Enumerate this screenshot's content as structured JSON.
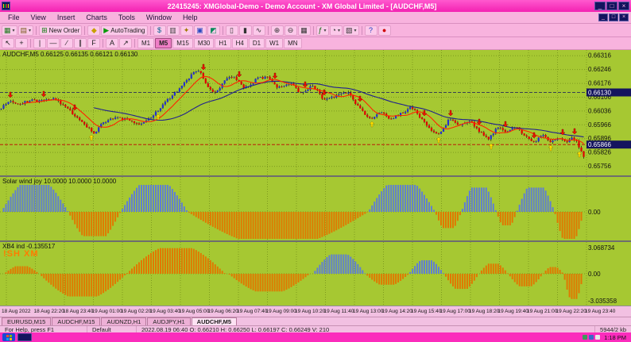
{
  "window": {
    "title": "22415245: XMGlobal-Demo - Demo Account - XM Global Limited - [AUDCHF,M5]",
    "minimize": "_",
    "maximize": "□",
    "close": "×"
  },
  "menu": {
    "items": [
      "File",
      "View",
      "Insert",
      "Charts",
      "Tools",
      "Window",
      "Help"
    ]
  },
  "toolbar_main": {
    "items": [
      {
        "name": "new-chart",
        "glyph": "▦",
        "color": "#1e7a1e",
        "dropdown": true
      },
      {
        "name": "profiles",
        "glyph": "▤",
        "color": "#7a5a1e",
        "dropdown": true
      },
      {
        "sep": true
      },
      {
        "name": "new-order",
        "glyph": "⊞",
        "color": "#0a7a0a",
        "label": "New Order"
      },
      {
        "sep": true
      },
      {
        "name": "metaeditor",
        "glyph": "◆",
        "color": "#c8a000"
      },
      {
        "name": "autotrading",
        "glyph": "▶",
        "color": "#0a9a0a",
        "label": "AutoTrading"
      },
      {
        "sep": true
      },
      {
        "name": "market-watch",
        "glyph": "$",
        "color": "#00608a"
      },
      {
        "name": "data-window",
        "glyph": "▥",
        "color": "#444444"
      },
      {
        "name": "navigator",
        "glyph": "✦",
        "color": "#a07a00"
      },
      {
        "name": "terminal",
        "glyph": "▣",
        "color": "#2a4ac0"
      },
      {
        "name": "strategy-tester",
        "glyph": "◩",
        "color": "#0a8a5a"
      },
      {
        "sep": true
      },
      {
        "name": "chart-bars",
        "glyph": "▯",
        "color": "#333333"
      },
      {
        "name": "chart-candles",
        "glyph": "▮",
        "color": "#333333"
      },
      {
        "name": "chart-line",
        "glyph": "∿",
        "color": "#333333"
      },
      {
        "sep": true
      },
      {
        "name": "zoom-in",
        "glyph": "⊕",
        "color": "#333333"
      },
      {
        "name": "zoom-out",
        "glyph": "⊖",
        "color": "#333333"
      },
      {
        "name": "tile-windows",
        "glyph": "▦",
        "color": "#333333"
      },
      {
        "sep": true
      },
      {
        "name": "indicators",
        "glyph": "ƒ",
        "color": "#0a6a0a",
        "dropdown": true
      },
      {
        "name": "periods",
        "glyph": "◔",
        "color": "#333333",
        "dropdown": true
      },
      {
        "name": "templates",
        "glyph": "▧",
        "color": "#333333",
        "dropdown": true
      },
      {
        "sep": true
      },
      {
        "name": "help",
        "glyph": "?",
        "color": "#1a3ac0"
      },
      {
        "name": "record",
        "glyph": "●",
        "color": "#d00000"
      }
    ]
  },
  "toolbar_tools": {
    "items": [
      {
        "name": "cursor-tool",
        "glyph": "↖",
        "color": "#222222"
      },
      {
        "name": "crosshair-tool",
        "glyph": "+",
        "color": "#222222"
      },
      {
        "sep": true
      },
      {
        "name": "vertical-line-tool",
        "glyph": "|",
        "color": "#222222"
      },
      {
        "name": "horizontal-line-tool",
        "glyph": "—",
        "color": "#222222"
      },
      {
        "name": "trendline-tool",
        "glyph": "∕",
        "color": "#222222"
      },
      {
        "name": "channel-tool",
        "glyph": "∥",
        "color": "#222222"
      },
      {
        "name": "fibonacci-tool",
        "glyph": "F",
        "color": "#222222"
      },
      {
        "sep": true
      },
      {
        "name": "text-tool",
        "glyph": "A",
        "color": "#222222"
      },
      {
        "name": "arrows-tool",
        "glyph": "↗",
        "color": "#222222"
      },
      {
        "sep": true
      }
    ]
  },
  "timeframes": {
    "items": [
      "M1",
      "M5",
      "M15",
      "M30",
      "H1",
      "H4",
      "D1",
      "W1",
      "MN"
    ],
    "active": "M5"
  },
  "chart": {
    "symbol_label": "AUDCHF,M5  0.66125 0.66135 0.66121 0.66130",
    "price_axis": [
      "0.66316",
      "0.66246",
      "0.66176",
      "0.66106",
      "0.66036",
      "0.65966",
      "0.65896",
      "0.65826",
      "0.65756"
    ],
    "price_box_upper": "0.66130",
    "price_box_lower": "0.65866",
    "time_axis": [
      "18 Aug 2022",
      "18 Aug 22:20",
      "18 Aug 23:40",
      "19 Aug 01:00",
      "19 Aug 02:20",
      "19 Aug 03:40",
      "19 Aug 05:00",
      "19 Aug 06:20",
      "19 Aug 07:40",
      "19 Aug 09:00",
      "19 Aug 10:20",
      "19 Aug 11:40",
      "19 Aug 13:00",
      "19 Aug 14:20",
      "19 Aug 15:40",
      "19 Aug 17:00",
      "19 Aug 18:20",
      "19 Aug 19:40",
      "19 Aug 21:00",
      "19 Aug 22:20",
      "19 Aug 23:40"
    ]
  },
  "indicator1": {
    "label": "Solar wind joy 10.0000 10.0000 10.0000",
    "zero_label": "0.00"
  },
  "indicator2": {
    "label": "XB4 ind -0.135517",
    "watermark": "!SH XM",
    "max_label": "3.068734",
    "zero_label": "0.00",
    "min_label": "-3.035358"
  },
  "tabs": {
    "items": [
      "EURUSD,M15",
      "AUDCHF,M15",
      "AUDNZD,H1",
      "AUDJPY,H1",
      "AUDCHF,M5"
    ],
    "active": "AUDCHF,M5"
  },
  "status_bar": {
    "help": "For Help, press F1",
    "profile": "Default",
    "ohlc": "2022.08.19 06:40   O: 0.66210   H: 0.66250   L: 0.66197   C: 0.66249   V: 210",
    "connection": "5944/2 kb"
  },
  "taskbar": {
    "clock": "1:18 PM"
  },
  "chart_data": {
    "type": "candlestick",
    "symbol": "AUDCHF",
    "timeframe": "M5",
    "candle_count": 246,
    "price_range": {
      "top": 0.66345,
      "bottom": 0.6571
    },
    "grid_prices": [
      0.66316,
      0.66246,
      0.66176,
      0.66106,
      0.66036,
      0.65966,
      0.65896,
      0.65826,
      0.65756
    ],
    "bid_line": 0.65866,
    "level_line": 0.6613,
    "ma_fast_period": 10,
    "ma_slow_period": 40,
    "price_keypoints": [
      [
        0,
        0.66055
      ],
      [
        0.012,
        0.66085
      ],
      [
        0.03,
        0.6607
      ],
      [
        0.05,
        0.6609
      ],
      [
        0.07,
        0.66085
      ],
      [
        0.09,
        0.661
      ],
      [
        0.11,
        0.66055
      ],
      [
        0.13,
        0.66005
      ],
      [
        0.15,
        0.6595
      ],
      [
        0.16,
        0.65925
      ],
      [
        0.175,
        0.6598
      ],
      [
        0.195,
        0.66
      ],
      [
        0.215,
        0.65995
      ],
      [
        0.24,
        0.6597
      ],
      [
        0.26,
        0.6601
      ],
      [
        0.285,
        0.6609
      ],
      [
        0.31,
        0.6616
      ],
      [
        0.33,
        0.6623
      ],
      [
        0.34,
        0.66245
      ],
      [
        0.352,
        0.6617
      ],
      [
        0.368,
        0.66125
      ],
      [
        0.385,
        0.66195
      ],
      [
        0.4,
        0.6621
      ],
      [
        0.418,
        0.6615
      ],
      [
        0.44,
        0.662
      ],
      [
        0.458,
        0.6621
      ],
      [
        0.475,
        0.6615
      ],
      [
        0.495,
        0.6618
      ],
      [
        0.515,
        0.66125
      ],
      [
        0.535,
        0.66165
      ],
      [
        0.555,
        0.6609
      ],
      [
        0.575,
        0.66115
      ],
      [
        0.595,
        0.6613
      ],
      [
        0.615,
        0.6605
      ],
      [
        0.635,
        0.6599
      ],
      [
        0.65,
        0.66035
      ],
      [
        0.668,
        0.65995
      ],
      [
        0.685,
        0.6602
      ],
      [
        0.705,
        0.66055
      ],
      [
        0.722,
        0.65995
      ],
      [
        0.74,
        0.6593
      ],
      [
        0.755,
        0.65925
      ],
      [
        0.77,
        0.66
      ],
      [
        0.788,
        0.65965
      ],
      [
        0.805,
        0.6599
      ],
      [
        0.82,
        0.65935
      ],
      [
        0.838,
        0.65895
      ],
      [
        0.852,
        0.65955
      ],
      [
        0.868,
        0.65925
      ],
      [
        0.885,
        0.6596
      ],
      [
        0.9,
        0.65905
      ],
      [
        0.915,
        0.65875
      ],
      [
        0.93,
        0.65915
      ],
      [
        0.945,
        0.65875
      ],
      [
        0.958,
        0.65905
      ],
      [
        0.97,
        0.6588
      ],
      [
        0.98,
        0.65905
      ],
      [
        0.99,
        0.6587
      ],
      [
        1,
        0.658
      ]
    ],
    "sell_arrows": [
      0.016,
      0.075,
      0.128,
      0.345,
      0.407,
      0.468,
      0.522,
      0.556,
      0.617,
      0.725,
      0.772,
      0.82,
      0.865,
      0.915,
      0.962,
      0.985
    ],
    "buy_arrows": [
      0.156,
      0.271,
      0.637,
      0.752,
      0.84,
      0.941,
      0.99
    ],
    "indicator1": {
      "name": "SolarWind",
      "range": [
        -11.5,
        11.5
      ],
      "segments": [
        [
          0,
          0.115,
          10
        ],
        [
          0.115,
          0.205,
          -9
        ],
        [
          0.205,
          0.32,
          10
        ],
        [
          0.32,
          0.63,
          -10
        ],
        [
          0.63,
          0.745,
          10
        ],
        [
          0.745,
          0.79,
          -6
        ],
        [
          0.79,
          0.85,
          9
        ],
        [
          0.85,
          0.885,
          -5
        ],
        [
          0.885,
          0.95,
          9
        ],
        [
          0.95,
          1,
          -10
        ]
      ]
    },
    "indicator2": {
      "name": "XB4",
      "value": -0.135517,
      "range": [
        -3.3,
        3.3
      ],
      "segments": [
        [
          0.005,
          0.065,
          0.9,
          "o"
        ],
        [
          0.065,
          0.215,
          -2.7,
          "o"
        ],
        [
          0.215,
          0.385,
          3.05,
          "o"
        ],
        [
          0.39,
          0.53,
          -2.1,
          "o"
        ],
        [
          0.535,
          0.625,
          2.3,
          "b"
        ],
        [
          0.625,
          0.7,
          -1.3,
          "o"
        ],
        [
          0.7,
          0.76,
          1.6,
          "b"
        ],
        [
          0.76,
          0.82,
          -1.8,
          "o"
        ],
        [
          0.82,
          0.87,
          1.2,
          "o"
        ],
        [
          0.87,
          0.93,
          -1.5,
          "o"
        ],
        [
          0.93,
          0.965,
          0.8,
          "o"
        ],
        [
          0.965,
          1,
          -3.0,
          "o"
        ]
      ]
    },
    "colors": {
      "bull": "#2330cf",
      "bear": "#e00000",
      "wick": "#151515",
      "bg": "#a6c832",
      "grid": "#7d9a1e",
      "ma_fast": "#ff2400",
      "ma_slow": "#20208e",
      "sell_arrow": "#ee1500",
      "buy_arrow": "#ffdf00",
      "hist_pos": "#5f7fd2",
      "hist_neg": "#e07800",
      "price_box_bg": "#14145e",
      "accent_pink": "#fb2cbc"
    }
  }
}
